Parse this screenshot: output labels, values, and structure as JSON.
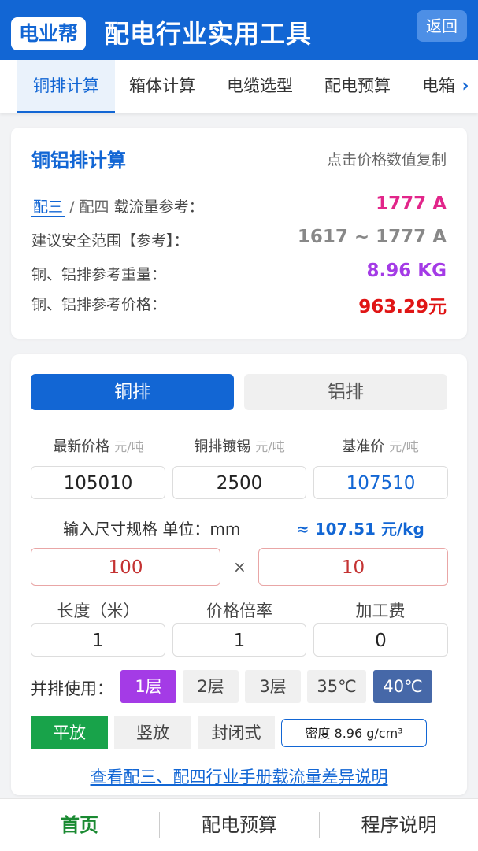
{
  "header": {
    "logo": "电业帮",
    "title": "配电行业实用工具",
    "back": "返回"
  },
  "tabs": [
    "铜排计算",
    "箱体计算",
    "电缆选型",
    "配电预算",
    "电箱"
  ],
  "summary": {
    "title": "铜铝排计算",
    "hint": "点击价格数值复制",
    "mode_a": "配三",
    "mode_sep": "/",
    "mode_b": "配四",
    "current_label": "载流量参考：",
    "current_value": "1777 A",
    "range_label": "建议安全范围【参考】：",
    "range_value": "1617 ~ 1777 A",
    "weight_label": "铜、铝排参考重量：",
    "weight_value": "8.96 KG",
    "price_label": "铜、铝排参考价格：",
    "price_value": "963.29元"
  },
  "calc": {
    "toggle_copper": "铜排",
    "toggle_aluminum": "铝排",
    "price_label": "最新价格",
    "tin_label": "铜排镀锡",
    "base_label": "基准价",
    "unit_ton": "元/吨",
    "price_value": "105010",
    "tin_value": "2500",
    "base_value": "107510",
    "size_label": "输入尺寸规格 单位：mm",
    "per_kg": "≈ 107.51 元/kg",
    "width_value": "100",
    "times": "×",
    "thickness_value": "10",
    "length_label": "长度（米）",
    "ratio_label": "价格倍率",
    "fee_label": "加工费",
    "length_value": "1",
    "ratio_value": "1",
    "fee_value": "0",
    "parallel_label": "并排使用：",
    "layers": [
      "1层",
      "2层",
      "3层"
    ],
    "temps": [
      "35℃",
      "40℃"
    ],
    "placements": [
      "平放",
      "竖放",
      "封闭式"
    ],
    "density": "密度 8.96 g/cm³",
    "manual_link": "查看配三、配四行业手册载流量差异说明"
  },
  "nav": [
    "首页",
    "配电预算",
    "程序说明"
  ],
  "colors": {
    "primary": "#1266d4",
    "current": "#e2258a",
    "weight": "#a43be6",
    "price": "#e01515",
    "layer_active": "#a43be6",
    "temp_active": "#4668a8",
    "green": "#18a34a"
  }
}
